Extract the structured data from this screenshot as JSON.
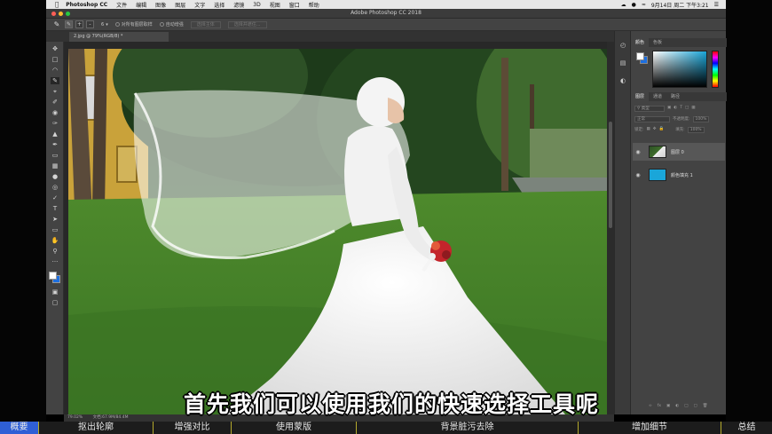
{
  "menubar": {
    "app_name": "Photoshop CC",
    "items": [
      "文件",
      "编辑",
      "图像",
      "图层",
      "文字",
      "选择",
      "滤镜",
      "3D",
      "视图",
      "窗口",
      "帮助"
    ],
    "datetime": "9月14日 周二 下午3:21"
  },
  "window": {
    "title": "Adobe Photoshop CC 2018"
  },
  "options": {
    "size_value": "6",
    "sample_all_layers": "对所有图层取样",
    "auto_enhance": "自动增强",
    "refine_edge": "选择主体",
    "select_mask": "选择并遮住..."
  },
  "document": {
    "tab_label": "2.jpg @ 79%(RGB/8) *"
  },
  "status": {
    "zoom": "79.02%",
    "doc_size": "文档:67.9M/84.4M"
  },
  "panels": {
    "color_tabs": [
      "颜色",
      "色板"
    ],
    "layer_tabs": [
      "图层",
      "通道",
      "路径"
    ],
    "kind_filter": "类型",
    "blend_mode": "正常",
    "opacity_label": "不透明度:",
    "opacity_value": "100%",
    "lock_label": "锁定:",
    "fill_label": "填充:",
    "fill_value": "100%",
    "layers": [
      {
        "name": "图层 0"
      },
      {
        "name": "颜色填充 1"
      }
    ]
  },
  "subtitle": "首先我们可以使用我们的快速选择工具呢",
  "chapters": {
    "items": [
      "概要",
      "抠出轮廓",
      "增强对比",
      "使用蒙版",
      "背景脏污去除",
      "增加细节",
      "总结"
    ],
    "current_index": 0
  },
  "colors": {
    "foreground": "#ffffff",
    "background": "#1d6fe0",
    "chapter_highlight": "#2f5fd6"
  }
}
